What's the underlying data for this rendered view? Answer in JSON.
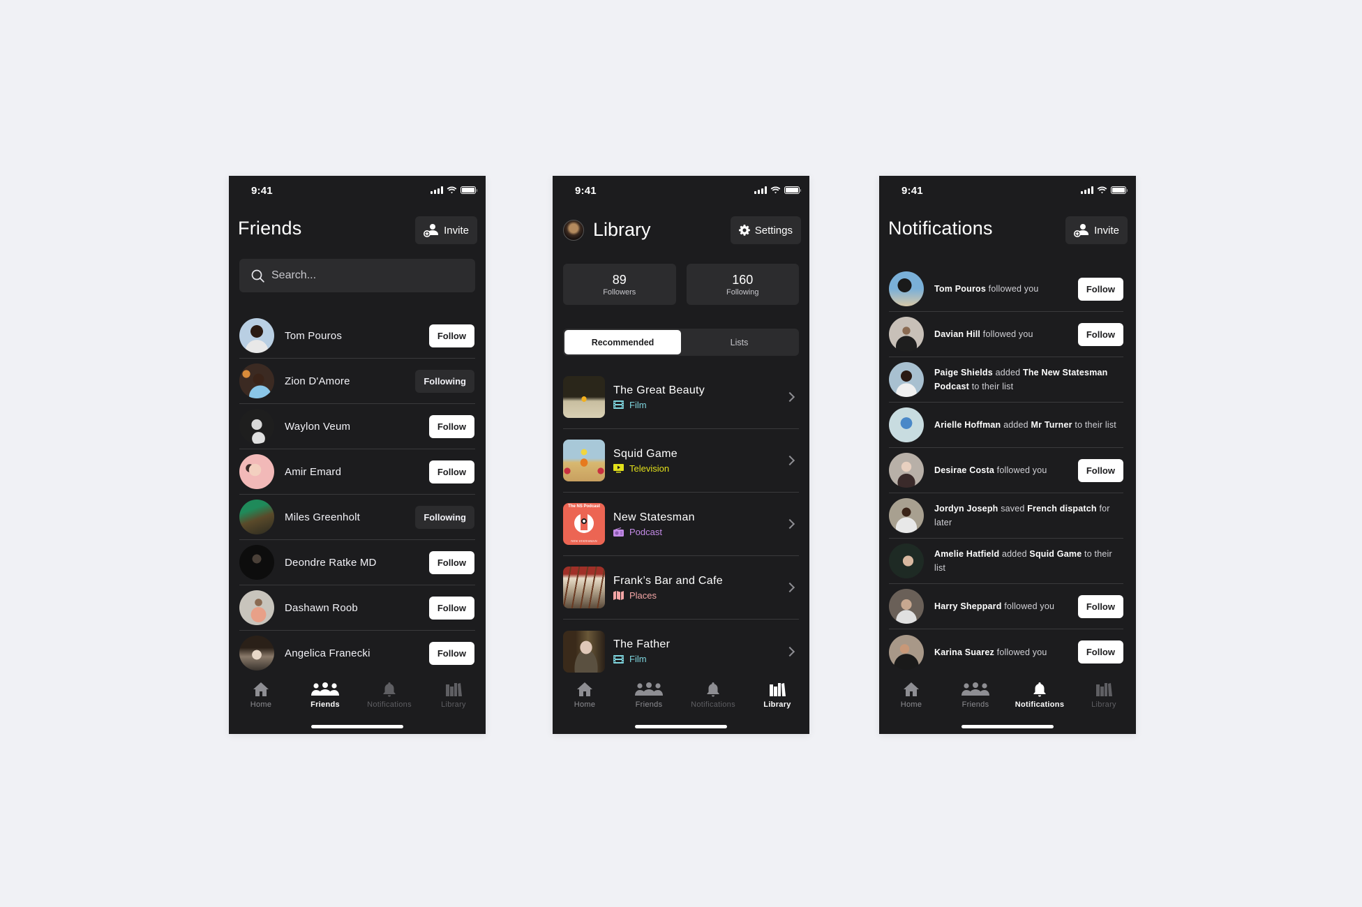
{
  "status_time": "9:41",
  "tab_bar": {
    "tabs": [
      {
        "key": "home",
        "label": "Home",
        "icon": "home-icon"
      },
      {
        "key": "friends",
        "label": "Friends",
        "icon": "friends-icon"
      },
      {
        "key": "notifications",
        "label": "Notifications",
        "icon": "bell-icon"
      },
      {
        "key": "library",
        "label": "Library",
        "icon": "library-icon"
      }
    ]
  },
  "friends_screen": {
    "title": "Friends",
    "invite_label": "Invite",
    "search_placeholder": "Search...",
    "active_tab": "Friends",
    "friends": [
      {
        "name": "Tom Pouros",
        "action": "Follow",
        "following": false
      },
      {
        "name": "Zion D'Amore",
        "action": "Following",
        "following": true
      },
      {
        "name": "Waylon Veum",
        "action": "Follow",
        "following": false
      },
      {
        "name": "Amir Emard",
        "action": "Follow",
        "following": false
      },
      {
        "name": "Miles Greenholt",
        "action": "Following",
        "following": true
      },
      {
        "name": "Deondre Ratke MD",
        "action": "Follow",
        "following": false
      },
      {
        "name": "Dashawn Roob",
        "action": "Follow",
        "following": false
      },
      {
        "name": "Angelica Franecki",
        "action": "Follow",
        "following": false
      }
    ]
  },
  "library_screen": {
    "title": "Library",
    "settings_label": "Settings",
    "active_tab": "Library",
    "stats": [
      {
        "value": "89",
        "label": "Followers"
      },
      {
        "value": "160",
        "label": "Following"
      }
    ],
    "segments": [
      {
        "label": "Recommended",
        "active": true
      },
      {
        "label": "Lists",
        "active": false
      }
    ],
    "items": [
      {
        "title": "The Great Beauty",
        "category": "Film",
        "category_icon": "film-icon",
        "color": "#7fd6df"
      },
      {
        "title": "Squid Game",
        "category": "Television",
        "category_icon": "tv-icon",
        "color": "#e2e01b"
      },
      {
        "title": "New Statesman",
        "category": "Podcast",
        "category_icon": "radio-icon",
        "color": "#c48be8",
        "thumb_text_top": "The NS Podcast",
        "thumb_text_bottom": "NEW STATESMAN"
      },
      {
        "title": "Frank’s Bar and Cafe",
        "category": "Places",
        "category_icon": "map-icon",
        "color": "#f4a6a6"
      },
      {
        "title": "The Father",
        "category": "Film",
        "category_icon": "film-icon",
        "color": "#7fd6df"
      }
    ]
  },
  "notifications_screen": {
    "title": "Notifications",
    "invite_label": "Invite",
    "active_tab": "Notifications",
    "items": [
      {
        "parts": [
          {
            "t": "Tom Pouros",
            "b": true
          },
          {
            "t": " followed you",
            "b": false
          }
        ],
        "action": "Follow"
      },
      {
        "parts": [
          {
            "t": "Davian Hill",
            "b": true
          },
          {
            "t": " followed you",
            "b": false
          }
        ],
        "action": "Follow"
      },
      {
        "parts": [
          {
            "t": "Paige Shields",
            "b": true
          },
          {
            "t": " added ",
            "b": false
          },
          {
            "t": "The New Statesman Podcast",
            "b": true
          },
          {
            "t": " to their list",
            "b": false
          }
        ],
        "action": null
      },
      {
        "parts": [
          {
            "t": "Arielle Hoffman",
            "b": true
          },
          {
            "t": " added ",
            "b": false
          },
          {
            "t": "Mr Turner",
            "b": true
          },
          {
            "t": " to their list",
            "b": false
          }
        ],
        "action": null
      },
      {
        "parts": [
          {
            "t": "Desirae Costa",
            "b": true
          },
          {
            "t": " followed you",
            "b": false
          }
        ],
        "action": "Follow"
      },
      {
        "parts": [
          {
            "t": "Jordyn Joseph",
            "b": true
          },
          {
            "t": " saved ",
            "b": false
          },
          {
            "t": "French dispatch",
            "b": true
          },
          {
            "t": " for later",
            "b": false
          }
        ],
        "action": null
      },
      {
        "parts": [
          {
            "t": "Amelie Hatfield",
            "b": true
          },
          {
            "t": " added ",
            "b": false
          },
          {
            "t": "Squid Game",
            "b": true
          },
          {
            "t": " to their list",
            "b": false
          }
        ],
        "action": null
      },
      {
        "parts": [
          {
            "t": "Harry Sheppard",
            "b": true
          },
          {
            "t": " followed you",
            "b": false
          }
        ],
        "action": "Follow"
      },
      {
        "parts": [
          {
            "t": "Karina Suarez",
            "b": true
          },
          {
            "t": " followed you",
            "b": false
          }
        ],
        "action": "Follow"
      }
    ]
  },
  "colors": {
    "screen_bg": "#1c1c1e",
    "card_bg": "#2c2c2e",
    "page_bg": "#f0f1f5",
    "film": "#7fd6df",
    "television": "#e2e01b",
    "podcast": "#c48be8",
    "places": "#f4a6a6"
  }
}
